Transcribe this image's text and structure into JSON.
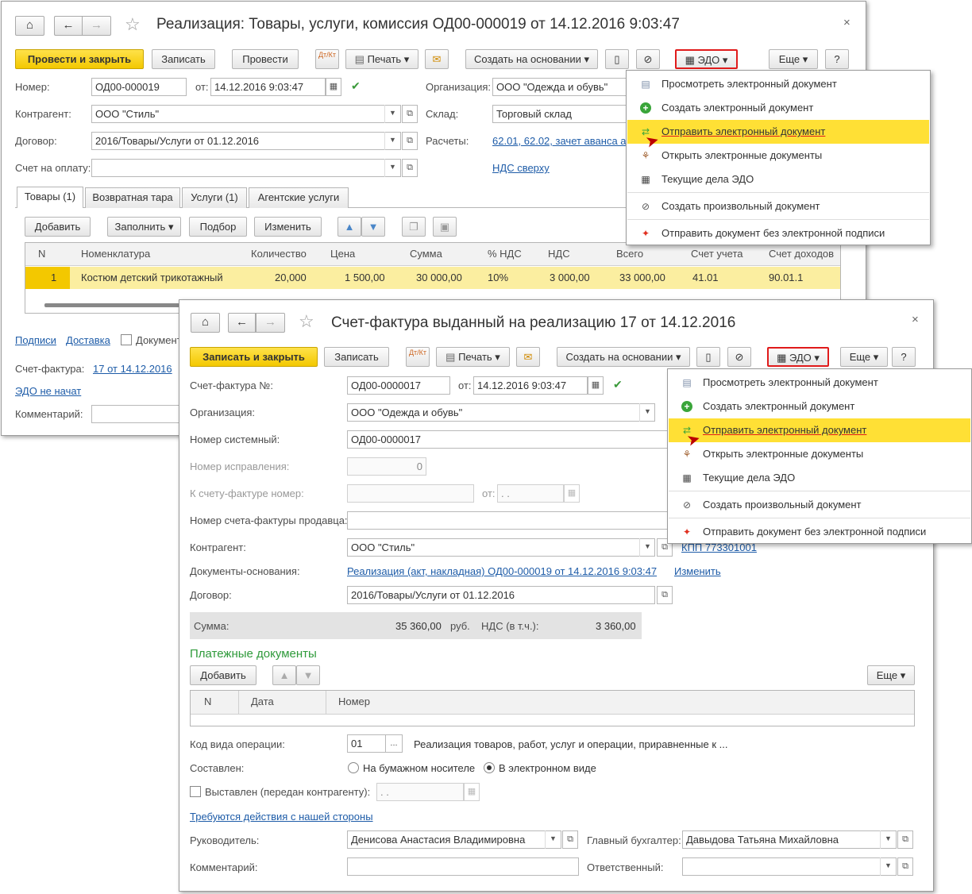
{
  "w1": {
    "title": "Реализация: Товары, услуги, комиссия ОД00-000019 от 14.12.2016 9:03:47",
    "toolbar": {
      "post_close": "Провести и закрыть",
      "save": "Записать",
      "post": "Провести",
      "dtkt": "Дт/Кт",
      "print": "Печать",
      "create_based": "Создать на основании",
      "edo": "ЭДО",
      "more": "Еще",
      "help": "?"
    },
    "fields": {
      "number_label": "Номер:",
      "number": "ОД00-000019",
      "from_label": "от:",
      "date": "14.12.2016  9:03:47",
      "org_label": "Организация:",
      "org": "ООО \"Одежда и обувь\"",
      "contractor_label": "Контрагент:",
      "contractor": "ООО \"Стиль\"",
      "warehouse_label": "Склад:",
      "warehouse": "Торговый склад",
      "contract_label": "Договор:",
      "contract": "2016/Товары/Услуги от 01.12.2016",
      "settlements_label": "Расчеты:",
      "settlements": "62.01, 62.02, зачет аванса а",
      "invoice_label": "Счет на оплату:",
      "vat_link": "НДС сверху"
    },
    "tabs": [
      "Товары (1)",
      "Возвратная тара",
      "Услуги (1)",
      "Агентские услуги"
    ],
    "table_toolbar": {
      "add": "Добавить",
      "fill": "Заполнить",
      "select": "Подбор",
      "change": "Изменить"
    },
    "table": {
      "headers": [
        "N",
        "Номенклатура",
        "Количество",
        "Цена",
        "Сумма",
        "% НДС",
        "НДС",
        "Всего",
        "Счет учета",
        "Счет доходов"
      ],
      "rows": [
        [
          "1",
          "Костюм детский трикотажный",
          "20,000",
          "1 500,00",
          "30 000,00",
          "10%",
          "3 000,00",
          "33 000,00",
          "41.01",
          "90.01.1"
        ]
      ]
    },
    "bottom": {
      "signatures": "Подписи",
      "delivery": "Доставка",
      "doc_chk": "Документ",
      "invoice_label": "Счет-фактура:",
      "invoice_link": "17 от 14.12.2016",
      "edo_status": "ЭДО не начат",
      "comment_label": "Комментарий:"
    }
  },
  "menu": {
    "items": [
      "Просмотреть электронный документ",
      "Создать электронный документ",
      "Отправить электронный документ",
      "Открыть электронные документы",
      "Текущие дела ЭДО",
      "Создать произвольный документ",
      "Отправить документ без электронной подписи"
    ]
  },
  "w2": {
    "title": "Счет-фактура выданный на реализацию 17 от 14.12.2016",
    "toolbar": {
      "save_close": "Записать и закрыть",
      "save": "Записать",
      "dtkt": "Дт/Кт",
      "print": "Печать",
      "create_based": "Создать на основании",
      "edo": "ЭДО",
      "more": "Еще",
      "help": "?"
    },
    "fields": {
      "inv_no_label": "Счет-фактура №:",
      "inv_no": "ОД00-0000017",
      "from_label": "от:",
      "date": "14.12.2016  9:03:47",
      "org_label": "Организация:",
      "org": "ООО \"Одежда и обувь\"",
      "sys_no_label": "Номер системный:",
      "sys_no": "ОД00-0000017",
      "fix_no_label": "Номер исправления:",
      "fix_no": "0",
      "to_inv_label": "К счету-фактуре номер:",
      "to_inv_from": "от:",
      "to_inv_date": " .  .",
      "seller_no_label": "Номер счета-фактуры продавца:",
      "contractor_label": "Контрагент:",
      "contractor": "ООО \"Стиль\"",
      "kpp_link": "КПП 773301001",
      "base_docs_label": "Документы-основания:",
      "base_doc_link": "Реализация (акт, накладная) ОД00-000019 от 14.12.2016 9:03:47",
      "change_link": "Изменить",
      "contract_label": "Договор:",
      "contract": "2016/Товары/Услуги от 01.12.2016",
      "sum_label": "Сумма:",
      "sum": "35 360,00",
      "currency": "руб.",
      "vat_label": "НДС (в т.ч.):",
      "vat": "3 360,00"
    },
    "payments": {
      "title": "Платежные документы",
      "add": "Добавить",
      "more": "Еще",
      "headers": [
        "N",
        "Дата",
        "Номер"
      ]
    },
    "bottom": {
      "op_code_label": "Код вида операции:",
      "op_code": "01",
      "op_code_ellipsis": "...",
      "op_desc": "Реализация товаров, работ, услуг и операции, приравненные к ...",
      "composed_label": "Составлен:",
      "paper": "На бумажном носителе",
      "electronic": "В электронном виде",
      "issued_label": "Выставлен (передан контрагенту):",
      "issued_date": " .  .",
      "actions_link": "Требуются действия с нашей стороны",
      "head_label": "Руководитель:",
      "head": "Денисова Анастасия Владимировна",
      "accountant_label": "Главный бухгалтер:",
      "accountant": "Давыдова Татьяна Михайловна",
      "comment_label": "Комментарий:",
      "responsible_label": "Ответственный:"
    }
  },
  "colors": {
    "accent_yellow": "#f3c800",
    "highlight": "#ffe035",
    "link": "#1e5ca8",
    "edo_border": "#e01b1b",
    "green_heading": "#2e9a3a"
  }
}
